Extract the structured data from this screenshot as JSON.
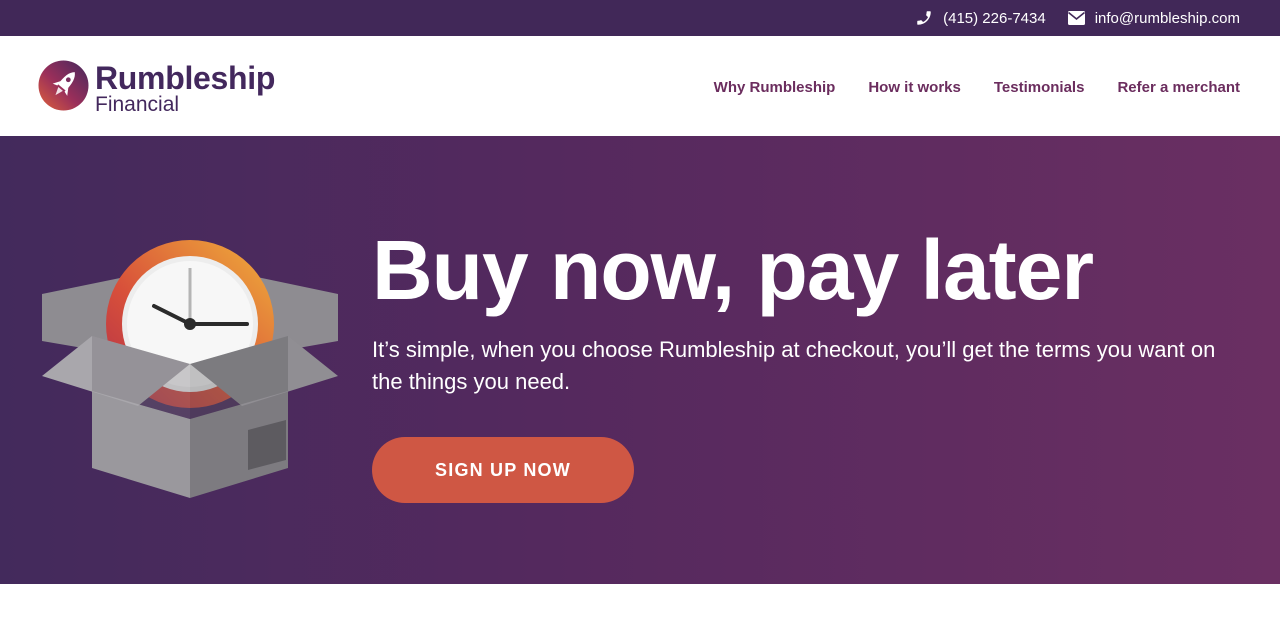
{
  "topbar": {
    "phone": "(415) 226-7434",
    "phone_icon": "phone-icon",
    "email": "info@rumbleship.com",
    "email_icon": "envelope-icon"
  },
  "brand": {
    "name": "Rumbleship",
    "subtitle": "Financial",
    "logo_icon": "rocket-icon",
    "color": "#43285d"
  },
  "nav": {
    "items": [
      {
        "label": "Why Rumbleship"
      },
      {
        "label": "How it works"
      },
      {
        "label": "Testimonials"
      },
      {
        "label": "Refer a merchant"
      }
    ],
    "color": "#6b2d5e"
  },
  "hero": {
    "title": "Buy now, pay later",
    "subtitle": "It’s simple, when you choose Rumbleship at checkout, you’ll get the terms you want on the things you need.",
    "cta_label": "SIGN UP NOW",
    "illustration": "clock-in-box-illustration",
    "cta_color": "#cf5744",
    "bg_colors": [
      "#432a5c",
      "#6a2f62"
    ]
  }
}
